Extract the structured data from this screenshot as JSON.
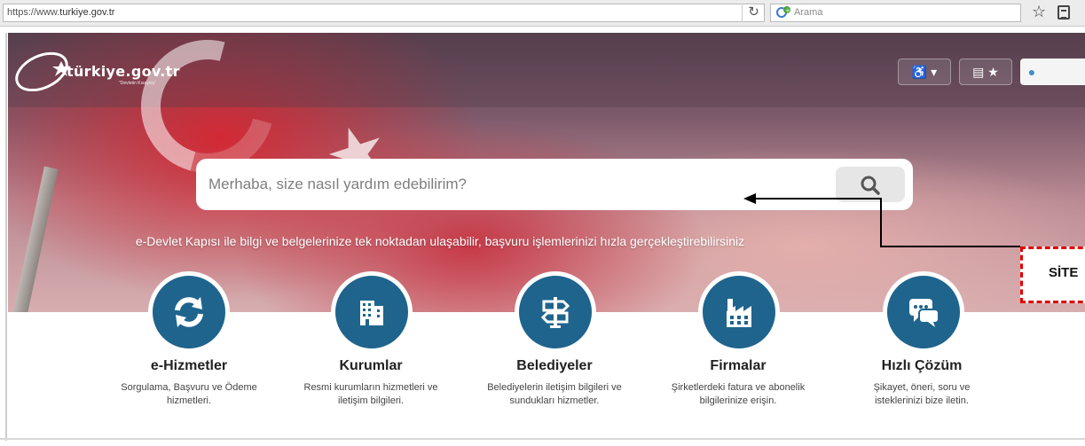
{
  "browser": {
    "url_prefix": "https://www.",
    "url_domain": "turkiye.gov.tr",
    "search_placeholder": "Arama"
  },
  "site": {
    "logo_text": "türkiye.gov.tr",
    "logo_tagline": "\"Devletin Kısayolu\""
  },
  "search": {
    "placeholder": "Merhaba, size nasıl yardım edebilirim?"
  },
  "tagline": "e-Devlet Kapısı ile bilgi ve belgelerinize tek noktadan ulaşabilir, başvuru işlemlerinizi hızla gerçekleştirebilirsiniz",
  "annotation": "SİTE",
  "categories": [
    {
      "title": "e-Hizmetler",
      "desc": "Sorgulama, Başvuru ve Ödeme hizmetleri.",
      "icon": "refresh-icon"
    },
    {
      "title": "Kurumlar",
      "desc": "Resmi kurumların hizmetleri ve iletişim bilgileri.",
      "icon": "building-icon"
    },
    {
      "title": "Belediyeler",
      "desc": "Belediyelerin iletişim bilgileri ve sundukları hizmetler.",
      "icon": "signpost-icon"
    },
    {
      "title": "Firmalar",
      "desc": "Şirketlerdeki fatura ve abonelik bilgilerinize erişin.",
      "icon": "factory-icon"
    },
    {
      "title": "Hızlı Çözüm",
      "desc": "Şikayet, öneri, soru ve isteklerinizi bize iletin.",
      "icon": "chat-icon"
    }
  ],
  "colors": {
    "circle": "#1f648d",
    "annotation_border": "#e00000"
  }
}
